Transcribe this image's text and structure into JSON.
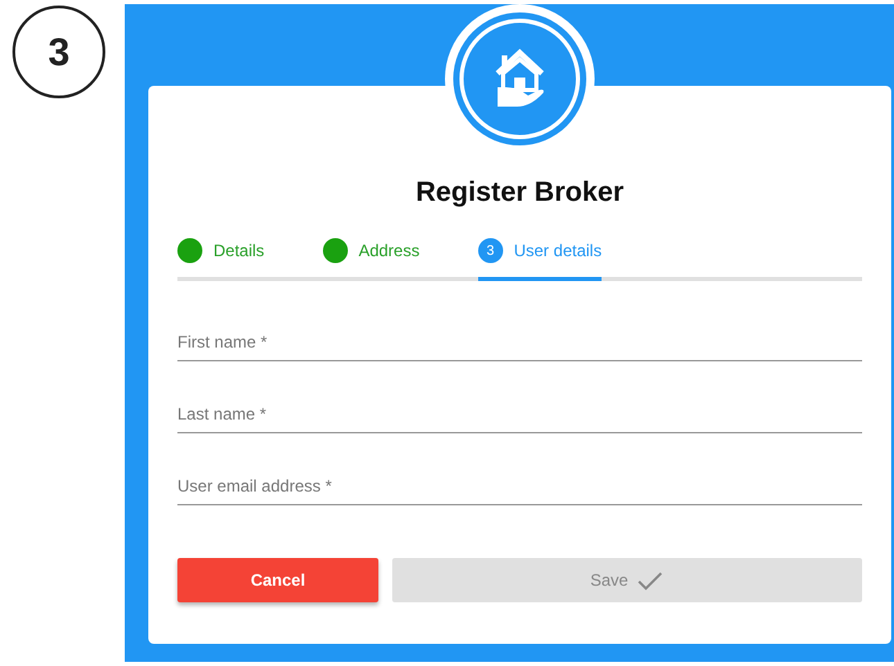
{
  "step_badge": "3",
  "dialog": {
    "title": "Register Broker",
    "steps": [
      {
        "label": "Details",
        "completed": true,
        "selected": false
      },
      {
        "label": "Address",
        "completed": true,
        "selected": false
      },
      {
        "label": "User details",
        "number": "3",
        "completed": false,
        "selected": true
      }
    ],
    "fields": [
      {
        "placeholder": "First name *"
      },
      {
        "placeholder": "Last name *"
      },
      {
        "placeholder": "User email address *"
      }
    ],
    "buttons": [
      {
        "label": "Cancel",
        "kind": "cancel",
        "disabled": false
      },
      {
        "label": "Save",
        "kind": "save",
        "disabled": true
      }
    ]
  }
}
